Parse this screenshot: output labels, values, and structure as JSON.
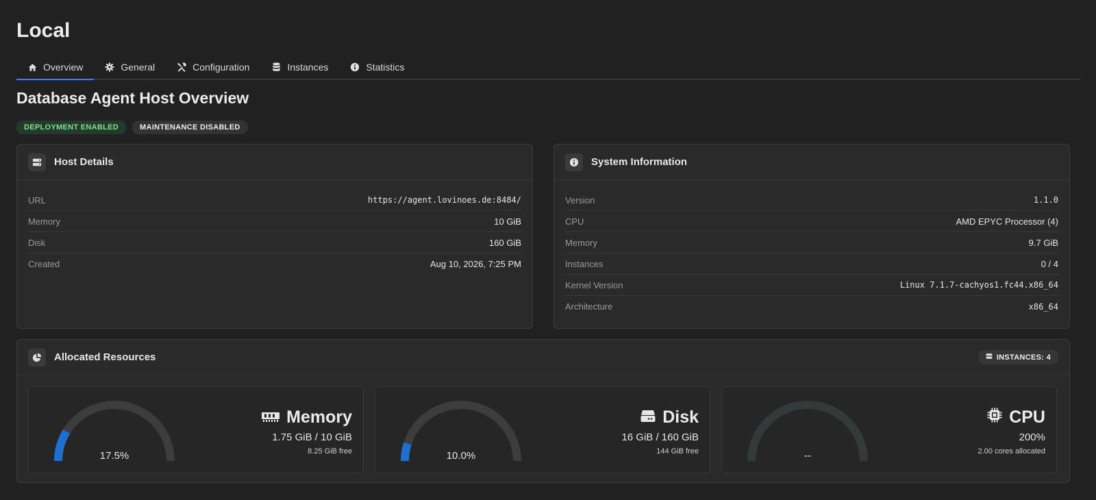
{
  "header": {
    "title": "Local"
  },
  "tabs": [
    {
      "label": "Overview",
      "icon": "home-icon",
      "active": true
    },
    {
      "label": "General",
      "icon": "gear-icon",
      "active": false
    },
    {
      "label": "Configuration",
      "icon": "tools-icon",
      "active": false
    },
    {
      "label": "Instances",
      "icon": "database-icon",
      "active": false
    },
    {
      "label": "Statistics",
      "icon": "info-icon",
      "active": false
    }
  ],
  "section": {
    "title": "Database Agent Host Overview"
  },
  "badges": {
    "deployment": "DEPLOYMENT ENABLED",
    "maintenance": "MAINTENANCE DISABLED"
  },
  "host_details": {
    "title": "Host Details",
    "rows": [
      {
        "key": "URL",
        "value": "https://agent.lovinoes.de:8484/"
      },
      {
        "key": "Memory",
        "value": "10 GiB"
      },
      {
        "key": "Disk",
        "value": "160 GiB"
      },
      {
        "key": "Created",
        "value": "Aug 10, 2026, 7:25 PM"
      }
    ]
  },
  "system_info": {
    "title": "System Information",
    "rows": [
      {
        "key": "Version",
        "value": "1.1.0"
      },
      {
        "key": "CPU",
        "value": "AMD EPYC Processor (4)"
      },
      {
        "key": "Memory",
        "value": "9.7 GiB"
      },
      {
        "key": "Instances",
        "value": "0 / 4"
      },
      {
        "key": "Kernel Version",
        "value": "Linux 7.1.7-cachyos1.fc44.x86_64"
      },
      {
        "key": "Architecture",
        "value": "x86_64"
      }
    ]
  },
  "resources": {
    "title": "Allocated Resources",
    "instances_badge": "INSTANCES: 4",
    "gauges": [
      {
        "name": "memory",
        "title": "Memory",
        "percent_label": "17.5%",
        "fraction": 0.175,
        "main": "1.75 GiB / 10 GiB",
        "sub": "8.25 GiB free"
      },
      {
        "name": "disk",
        "title": "Disk",
        "percent_label": "10.0%",
        "fraction": 0.1,
        "main": "16 GiB / 160 GiB",
        "sub": "144 GiB free"
      },
      {
        "name": "cpu",
        "title": "CPU",
        "percent_label": "--",
        "fraction": 0,
        "main": "200%",
        "sub": "2.00 cores allocated"
      }
    ]
  },
  "colors": {
    "accent": "#3b82f6",
    "gauge_fill": "#1e6fd0",
    "gauge_track": "#3d3d3d",
    "gauge_track_cpu": "#343a3a",
    "badge_green_text": "#7fe08f"
  }
}
